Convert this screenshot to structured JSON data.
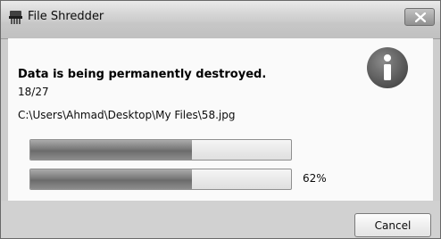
{
  "window": {
    "title": "File Shredder",
    "close_icon": "close-icon",
    "app_icon": "shredder-icon"
  },
  "content": {
    "info_icon": "info-icon",
    "heading": "Data is being permanently destroyed.",
    "counter": "18/27",
    "file_path": "C:\\Users\\Ahmad\\Desktop\\My Files\\58.jpg",
    "file_progress": 0.62,
    "overall_progress": 0.62,
    "overall_percent_label": "62%"
  },
  "footer": {
    "cancel_label": "Cancel"
  }
}
